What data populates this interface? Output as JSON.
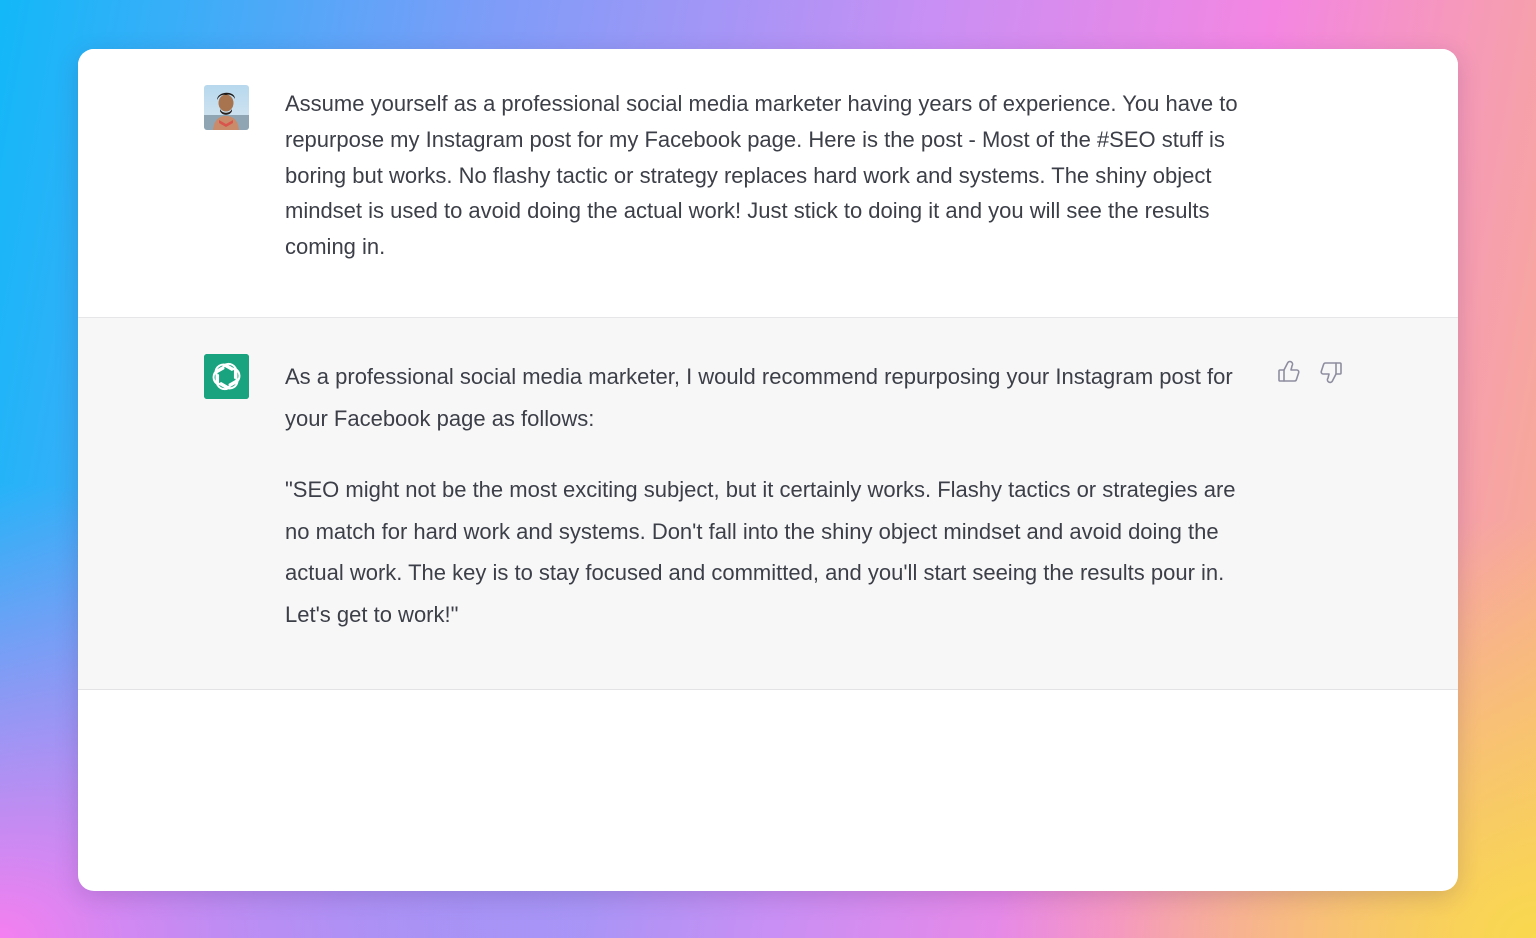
{
  "conversation": {
    "user": {
      "avatar_icon": "user-avatar-photo",
      "message": "Assume yourself as a professional social media marketer having years of experience. You have to repurpose my Instagram post for my Facebook page. Here is the post - Most of the #SEO stuff is boring but works. No flashy tactic or strategy replaces hard work and systems. The shiny object mindset is used to avoid doing the actual work! Just stick to doing it and you will see the results coming in."
    },
    "assistant": {
      "avatar_icon": "openai-logo-icon",
      "avatar_color": "#19a37f",
      "paragraphs": [
        "As a professional social media marketer, I would recommend repurposing your Instagram post for your Facebook page as follows:",
        "\"SEO might not be the most exciting subject, but it certainly works. Flashy tactics or strategies are no match for hard work and systems. Don't fall into the shiny object mindset and avoid doing the actual work. The key is to stay focused and committed, and you'll start seeing the results pour in. Let's get to work!\""
      ],
      "feedback": {
        "like_icon": "thumbs-up-icon",
        "dislike_icon": "thumbs-down-icon"
      }
    }
  }
}
